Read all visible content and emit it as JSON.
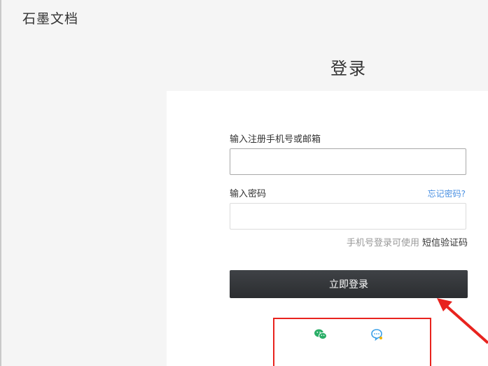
{
  "header": {
    "brand": "石墨文档"
  },
  "login": {
    "title": "登录",
    "account_label": "输入注册手机号或邮箱",
    "account_value": "",
    "password_label": "输入密码",
    "password_value": "",
    "forgot_link": "忘记密码?",
    "sms_hint": "手机号登录可使用",
    "sms_link": "短信验证码",
    "submit_label": "立即登录"
  },
  "social_login": {
    "icons": [
      "wechat-icon",
      "qq-icon"
    ],
    "wechat_color": "#2aae67",
    "qq_color": "#3aa0e8"
  },
  "annotation": {
    "highlight_color": "#e8231e"
  }
}
